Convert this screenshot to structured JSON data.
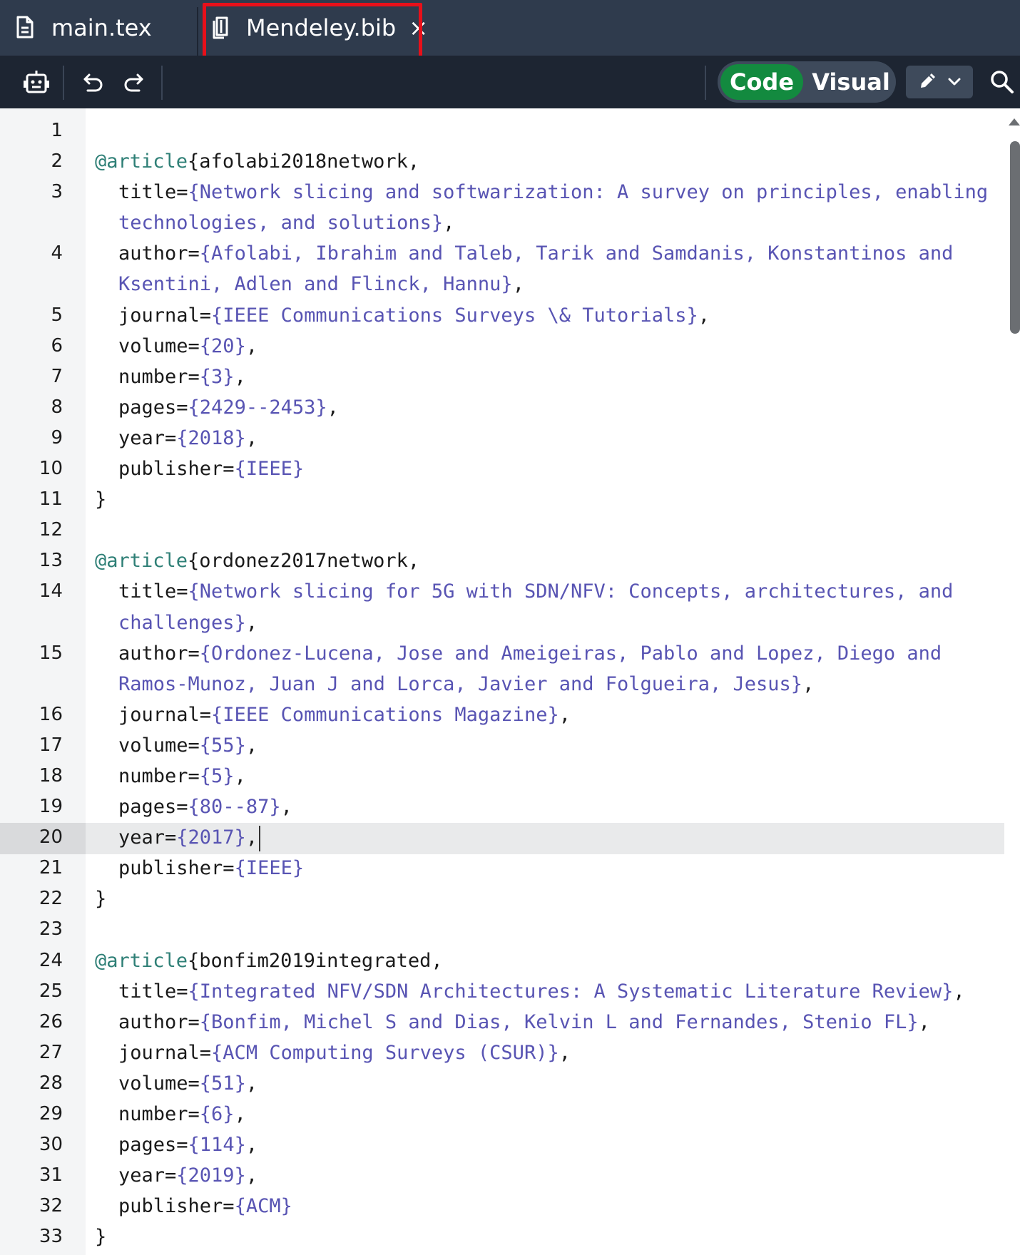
{
  "tabs": [
    {
      "label": "main.tex",
      "icon": "document-icon",
      "active": false
    },
    {
      "label": "Mendeley.bib",
      "icon": "book-icon",
      "active": true,
      "close": "×"
    }
  ],
  "toolbar": {
    "mode_code": "Code",
    "mode_visual": "Visual",
    "active_mode": "Code",
    "icons": [
      "robot-icon",
      "undo-icon",
      "redo-icon",
      "pencil-icon",
      "chevron-down-icon",
      "search-icon"
    ]
  },
  "editor": {
    "current_line": 20,
    "lines": [
      {
        "n": "1",
        "indent": false,
        "segs": []
      },
      {
        "n": "2",
        "indent": false,
        "segs": [
          [
            "kw",
            "@article"
          ],
          [
            "t",
            "{afolabi2018network,"
          ]
        ]
      },
      {
        "n": "3",
        "indent": true,
        "segs": [
          [
            "t",
            "title="
          ],
          [
            "s",
            "{Network slicing and softwarization: A survey on principles, enabling"
          ]
        ]
      },
      {
        "n": "",
        "indent": true,
        "segs": [
          [
            "s",
            "technologies, and solutions}"
          ],
          [
            "t",
            ","
          ]
        ]
      },
      {
        "n": "4",
        "indent": true,
        "segs": [
          [
            "t",
            "author="
          ],
          [
            "s",
            "{Afolabi, Ibrahim and Taleb, Tarik and Samdanis, Konstantinos and"
          ]
        ]
      },
      {
        "n": "",
        "indent": true,
        "segs": [
          [
            "s",
            "Ksentini, Adlen and Flinck, Hannu}"
          ],
          [
            "t",
            ","
          ]
        ]
      },
      {
        "n": "5",
        "indent": true,
        "segs": [
          [
            "t",
            "journal="
          ],
          [
            "s",
            "{IEEE Communications Surveys \\& Tutorials}"
          ],
          [
            "t",
            ","
          ]
        ]
      },
      {
        "n": "6",
        "indent": true,
        "segs": [
          [
            "t",
            "volume="
          ],
          [
            "s",
            "{20}"
          ],
          [
            "t",
            ","
          ]
        ]
      },
      {
        "n": "7",
        "indent": true,
        "segs": [
          [
            "t",
            "number="
          ],
          [
            "s",
            "{3}"
          ],
          [
            "t",
            ","
          ]
        ]
      },
      {
        "n": "8",
        "indent": true,
        "segs": [
          [
            "t",
            "pages="
          ],
          [
            "s",
            "{2429--2453}"
          ],
          [
            "t",
            ","
          ]
        ]
      },
      {
        "n": "9",
        "indent": true,
        "segs": [
          [
            "t",
            "year="
          ],
          [
            "s",
            "{2018}"
          ],
          [
            "t",
            ","
          ]
        ]
      },
      {
        "n": "10",
        "indent": true,
        "segs": [
          [
            "t",
            "publisher="
          ],
          [
            "s",
            "{IEEE}"
          ]
        ]
      },
      {
        "n": "11",
        "indent": false,
        "segs": [
          [
            "t",
            "}"
          ]
        ]
      },
      {
        "n": "12",
        "indent": false,
        "segs": []
      },
      {
        "n": "13",
        "indent": false,
        "segs": [
          [
            "kw",
            "@article"
          ],
          [
            "t",
            "{ordonez2017network,"
          ]
        ]
      },
      {
        "n": "14",
        "indent": true,
        "segs": [
          [
            "t",
            "title="
          ],
          [
            "s",
            "{Network slicing for 5G with SDN/NFV: Concepts, architectures, and"
          ]
        ]
      },
      {
        "n": "",
        "indent": true,
        "segs": [
          [
            "s",
            "challenges}"
          ],
          [
            "t",
            ","
          ]
        ]
      },
      {
        "n": "15",
        "indent": true,
        "segs": [
          [
            "t",
            "author="
          ],
          [
            "s",
            "{Ordonez-Lucena, Jose and Ameigeiras, Pablo and Lopez, Diego and"
          ]
        ]
      },
      {
        "n": "",
        "indent": true,
        "segs": [
          [
            "s",
            "Ramos-Munoz, Juan J and Lorca, Javier and Folgueira, Jesus}"
          ],
          [
            "t",
            ","
          ]
        ]
      },
      {
        "n": "16",
        "indent": true,
        "segs": [
          [
            "t",
            "journal="
          ],
          [
            "s",
            "{IEEE Communications Magazine}"
          ],
          [
            "t",
            ","
          ]
        ]
      },
      {
        "n": "17",
        "indent": true,
        "segs": [
          [
            "t",
            "volume="
          ],
          [
            "s",
            "{55}"
          ],
          [
            "t",
            ","
          ]
        ]
      },
      {
        "n": "18",
        "indent": true,
        "segs": [
          [
            "t",
            "number="
          ],
          [
            "s",
            "{5}"
          ],
          [
            "t",
            ","
          ]
        ]
      },
      {
        "n": "19",
        "indent": true,
        "segs": [
          [
            "t",
            "pages="
          ],
          [
            "s",
            "{80--87}"
          ],
          [
            "t",
            ","
          ]
        ]
      },
      {
        "n": "20",
        "indent": true,
        "segs": [
          [
            "t",
            "year="
          ],
          [
            "s",
            "{2017}"
          ],
          [
            "t",
            ","
          ]
        ],
        "caret": true
      },
      {
        "n": "21",
        "indent": true,
        "segs": [
          [
            "t",
            "publisher="
          ],
          [
            "s",
            "{IEEE}"
          ]
        ]
      },
      {
        "n": "22",
        "indent": false,
        "segs": [
          [
            "t",
            "}"
          ]
        ]
      },
      {
        "n": "23",
        "indent": false,
        "segs": []
      },
      {
        "n": "24",
        "indent": false,
        "segs": [
          [
            "kw",
            "@article"
          ],
          [
            "t",
            "{bonfim2019integrated,"
          ]
        ]
      },
      {
        "n": "25",
        "indent": true,
        "segs": [
          [
            "t",
            "title="
          ],
          [
            "s",
            "{Integrated NFV/SDN Architectures: A Systematic Literature Review}"
          ],
          [
            "t",
            ","
          ]
        ]
      },
      {
        "n": "26",
        "indent": true,
        "segs": [
          [
            "t",
            "author="
          ],
          [
            "s",
            "{Bonfim, Michel S and Dias, Kelvin L and Fernandes, Stenio FL}"
          ],
          [
            "t",
            ","
          ]
        ]
      },
      {
        "n": "27",
        "indent": true,
        "segs": [
          [
            "t",
            "journal="
          ],
          [
            "s",
            "{ACM Computing Surveys (CSUR)}"
          ],
          [
            "t",
            ","
          ]
        ]
      },
      {
        "n": "28",
        "indent": true,
        "segs": [
          [
            "t",
            "volume="
          ],
          [
            "s",
            "{51}"
          ],
          [
            "t",
            ","
          ]
        ]
      },
      {
        "n": "29",
        "indent": true,
        "segs": [
          [
            "t",
            "number="
          ],
          [
            "s",
            "{6}"
          ],
          [
            "t",
            ","
          ]
        ]
      },
      {
        "n": "30",
        "indent": true,
        "segs": [
          [
            "t",
            "pages="
          ],
          [
            "s",
            "{114}"
          ],
          [
            "t",
            ","
          ]
        ]
      },
      {
        "n": "31",
        "indent": true,
        "segs": [
          [
            "t",
            "year="
          ],
          [
            "s",
            "{2019}"
          ],
          [
            "t",
            ","
          ]
        ]
      },
      {
        "n": "32",
        "indent": true,
        "segs": [
          [
            "t",
            "publisher="
          ],
          [
            "s",
            "{ACM}"
          ]
        ]
      },
      {
        "n": "33",
        "indent": false,
        "segs": [
          [
            "t",
            "}"
          ]
        ]
      }
    ]
  },
  "colors": {
    "tabbar_bg": "#2f3b4d",
    "toolbar_bg": "#1d2532",
    "code_toggle_active": "#138a3f",
    "keyword": "#2e7f76",
    "string": "#5854b3",
    "highlight_box": "#e8101a"
  }
}
